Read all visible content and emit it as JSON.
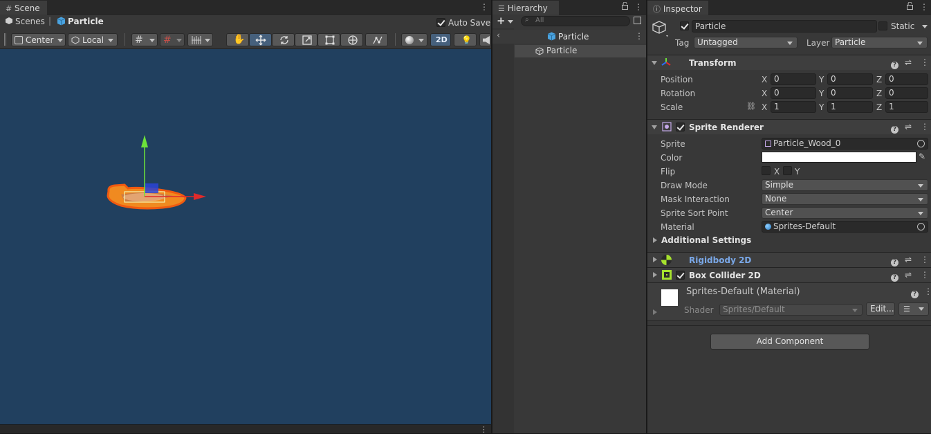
{
  "scene": {
    "tab_label": "Scene",
    "breadcrumb_scenes": "Scenes",
    "breadcrumb_object": "Particle",
    "auto_save_label": "Auto Save",
    "pivot_mode": "Center",
    "pivot_rotation": "Local",
    "mode_2d": "2D",
    "bg_color": "#21405f"
  },
  "hierarchy": {
    "tab_label": "Hierarchy",
    "search_placeholder": "All",
    "root_label": "Particle",
    "child_label": "Particle"
  },
  "inspector": {
    "tab_label": "Inspector",
    "object_name": "Particle",
    "static_label": "Static",
    "tag_label": "Tag",
    "tag_value": "Untagged",
    "layer_label": "Layer",
    "layer_value": "Particle",
    "transform": {
      "title": "Transform",
      "position_label": "Position",
      "rotation_label": "Rotation",
      "scale_label": "Scale",
      "position": {
        "x": "0",
        "y": "0",
        "z": "0"
      },
      "rotation": {
        "x": "0",
        "y": "0",
        "z": "0"
      },
      "scale": {
        "x": "1",
        "y": "1",
        "z": "1"
      },
      "axis_x": "X",
      "axis_y": "Y",
      "axis_z": "Z"
    },
    "sprite_renderer": {
      "title": "Sprite Renderer",
      "sprite_label": "Sprite",
      "sprite_value": "Particle_Wood_0",
      "color_label": "Color",
      "flip_label": "Flip",
      "flip_x": "X",
      "flip_y": "Y",
      "draw_mode_label": "Draw Mode",
      "draw_mode_value": "Simple",
      "mask_label": "Mask Interaction",
      "mask_value": "None",
      "sort_point_label": "Sprite Sort Point",
      "sort_point_value": "Center",
      "material_label": "Material",
      "material_value": "Sprites-Default",
      "additional_label": "Additional Settings"
    },
    "rigidbody": {
      "title": "Rigidbody 2D"
    },
    "box_collider": {
      "title": "Box Collider 2D"
    },
    "material": {
      "title": "Sprites-Default (Material)",
      "shader_label": "Shader",
      "shader_value": "Sprites/Default",
      "edit_label": "Edit..."
    },
    "add_component_label": "Add Component"
  }
}
